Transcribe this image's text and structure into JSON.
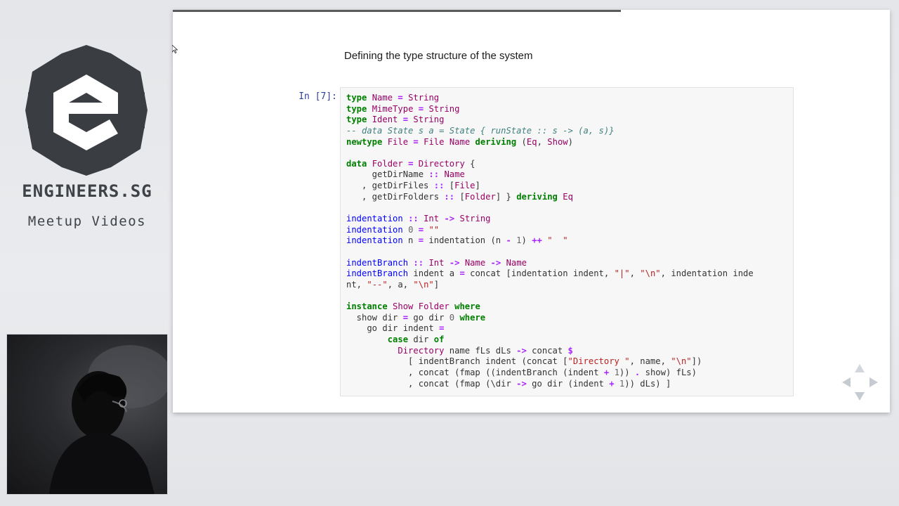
{
  "branding": {
    "name": "ENGINEERS.SG",
    "subtitle": "Meetup Videos"
  },
  "slide": {
    "title": "Defining the type structure of the system",
    "progress_fraction": 0.625,
    "cell_prompt": "In [7]:",
    "code_lines": [
      [
        {
          "t": "type",
          "c": "kw"
        },
        {
          "t": " "
        },
        {
          "t": "Name",
          "c": "type"
        },
        {
          "t": " "
        },
        {
          "t": "=",
          "c": "op"
        },
        {
          "t": " "
        },
        {
          "t": "String",
          "c": "type"
        }
      ],
      [
        {
          "t": "type",
          "c": "kw"
        },
        {
          "t": " "
        },
        {
          "t": "MimeType",
          "c": "type"
        },
        {
          "t": " "
        },
        {
          "t": "=",
          "c": "op"
        },
        {
          "t": " "
        },
        {
          "t": "String",
          "c": "type"
        }
      ],
      [
        {
          "t": "type",
          "c": "kw"
        },
        {
          "t": " "
        },
        {
          "t": "Ident",
          "c": "type"
        },
        {
          "t": " "
        },
        {
          "t": "=",
          "c": "op"
        },
        {
          "t": " "
        },
        {
          "t": "String",
          "c": "type"
        }
      ],
      [
        {
          "t": "-- data State s a = State { runState :: s -> (a, s)}",
          "c": "comment"
        }
      ],
      [
        {
          "t": "newtype",
          "c": "kw"
        },
        {
          "t": " "
        },
        {
          "t": "File",
          "c": "type"
        },
        {
          "t": " "
        },
        {
          "t": "=",
          "c": "op"
        },
        {
          "t": " "
        },
        {
          "t": "File",
          "c": "type"
        },
        {
          "t": " "
        },
        {
          "t": "Name",
          "c": "type"
        },
        {
          "t": " "
        },
        {
          "t": "deriving",
          "c": "kw"
        },
        {
          "t": " ("
        },
        {
          "t": "Eq",
          "c": "type"
        },
        {
          "t": ", "
        },
        {
          "t": "Show",
          "c": "type"
        },
        {
          "t": ")"
        }
      ],
      [],
      [
        {
          "t": "data",
          "c": "kw"
        },
        {
          "t": " "
        },
        {
          "t": "Folder",
          "c": "type"
        },
        {
          "t": " "
        },
        {
          "t": "=",
          "c": "op"
        },
        {
          "t": " "
        },
        {
          "t": "Directory",
          "c": "type"
        },
        {
          "t": " {"
        }
      ],
      [
        {
          "t": "     getDirName "
        },
        {
          "t": "::",
          "c": "op"
        },
        {
          "t": " "
        },
        {
          "t": "Name",
          "c": "type"
        }
      ],
      [
        {
          "t": "   , getDirFiles "
        },
        {
          "t": "::",
          "c": "op"
        },
        {
          "t": " ["
        },
        {
          "t": "File",
          "c": "type"
        },
        {
          "t": "]"
        }
      ],
      [
        {
          "t": "   , getDirFolders "
        },
        {
          "t": "::",
          "c": "op"
        },
        {
          "t": " ["
        },
        {
          "t": "Folder",
          "c": "type"
        },
        {
          "t": "] } "
        },
        {
          "t": "deriving",
          "c": "kw"
        },
        {
          "t": " "
        },
        {
          "t": "Eq",
          "c": "type"
        }
      ],
      [],
      [
        {
          "t": "indentation",
          "c": "name"
        },
        {
          "t": " "
        },
        {
          "t": "::",
          "c": "op"
        },
        {
          "t": " "
        },
        {
          "t": "Int",
          "c": "type"
        },
        {
          "t": " "
        },
        {
          "t": "->",
          "c": "op"
        },
        {
          "t": " "
        },
        {
          "t": "String",
          "c": "type"
        }
      ],
      [
        {
          "t": "indentation",
          "c": "name"
        },
        {
          "t": " "
        },
        {
          "t": "0",
          "c": "num"
        },
        {
          "t": " "
        },
        {
          "t": "=",
          "c": "op"
        },
        {
          "t": " "
        },
        {
          "t": "\"\"",
          "c": "str"
        }
      ],
      [
        {
          "t": "indentation",
          "c": "name"
        },
        {
          "t": " n "
        },
        {
          "t": "=",
          "c": "op"
        },
        {
          "t": " indentation (n "
        },
        {
          "t": "-",
          "c": "op"
        },
        {
          "t": " "
        },
        {
          "t": "1",
          "c": "num"
        },
        {
          "t": ") "
        },
        {
          "t": "++",
          "c": "op"
        },
        {
          "t": " "
        },
        {
          "t": "\"  \"",
          "c": "str"
        }
      ],
      [],
      [
        {
          "t": "indentBranch",
          "c": "name"
        },
        {
          "t": " "
        },
        {
          "t": "::",
          "c": "op"
        },
        {
          "t": " "
        },
        {
          "t": "Int",
          "c": "type"
        },
        {
          "t": " "
        },
        {
          "t": "->",
          "c": "op"
        },
        {
          "t": " "
        },
        {
          "t": "Name",
          "c": "type"
        },
        {
          "t": " "
        },
        {
          "t": "->",
          "c": "op"
        },
        {
          "t": " "
        },
        {
          "t": "Name",
          "c": "type"
        }
      ],
      [
        {
          "t": "indentBranch",
          "c": "name"
        },
        {
          "t": " indent a "
        },
        {
          "t": "=",
          "c": "op"
        },
        {
          "t": " concat [indentation indent, "
        },
        {
          "t": "\"|\"",
          "c": "str"
        },
        {
          "t": ", "
        },
        {
          "t": "\"\\n\"",
          "c": "str"
        },
        {
          "t": ", indentation inde"
        }
      ],
      [
        {
          "t": "nt, "
        },
        {
          "t": "\"--\"",
          "c": "str"
        },
        {
          "t": ", a, "
        },
        {
          "t": "\"\\n\"",
          "c": "str"
        },
        {
          "t": "]"
        }
      ],
      [],
      [
        {
          "t": "instance",
          "c": "kw"
        },
        {
          "t": " "
        },
        {
          "t": "Show",
          "c": "type"
        },
        {
          "t": " "
        },
        {
          "t": "Folder",
          "c": "type"
        },
        {
          "t": " "
        },
        {
          "t": "where",
          "c": "kw"
        }
      ],
      [
        {
          "t": "  show dir "
        },
        {
          "t": "=",
          "c": "op"
        },
        {
          "t": " go dir "
        },
        {
          "t": "0",
          "c": "num"
        },
        {
          "t": " "
        },
        {
          "t": "where",
          "c": "kw"
        }
      ],
      [
        {
          "t": "    go dir indent "
        },
        {
          "t": "=",
          "c": "op"
        }
      ],
      [
        {
          "t": "        "
        },
        {
          "t": "case",
          "c": "kw"
        },
        {
          "t": " dir "
        },
        {
          "t": "of",
          "c": "kw"
        }
      ],
      [
        {
          "t": "          "
        },
        {
          "t": "Directory",
          "c": "type"
        },
        {
          "t": " name fLs dLs "
        },
        {
          "t": "->",
          "c": "op"
        },
        {
          "t": " concat "
        },
        {
          "t": "$",
          "c": "op"
        }
      ],
      [
        {
          "t": "            [ indentBranch indent (concat ["
        },
        {
          "t": "\"Directory \"",
          "c": "str"
        },
        {
          "t": ", name, "
        },
        {
          "t": "\"\\n\"",
          "c": "str"
        },
        {
          "t": "])"
        }
      ],
      [
        {
          "t": "            , concat (fmap ((indentBranch (indent "
        },
        {
          "t": "+",
          "c": "op"
        },
        {
          "t": " "
        },
        {
          "t": "1",
          "c": "num"
        },
        {
          "t": ")) "
        },
        {
          "t": ".",
          "c": "op"
        },
        {
          "t": " show) fLs)"
        }
      ],
      [
        {
          "t": "            , concat (fmap (\\dir "
        },
        {
          "t": "->",
          "c": "op"
        },
        {
          "t": " go dir (indent "
        },
        {
          "t": "+",
          "c": "op"
        },
        {
          "t": " "
        },
        {
          "t": "1",
          "c": "num"
        },
        {
          "t": ")) dLs) ]"
        }
      ]
    ]
  },
  "nav": {
    "up_icon": "chevron-up",
    "down_icon": "chevron-down",
    "left_icon": "chevron-left",
    "right_icon": "chevron-right"
  },
  "colors": {
    "keyword": "#008000",
    "type": "#990066",
    "operator": "#aa22ff",
    "comment": "#408080",
    "string": "#ba2121",
    "number": "#666666",
    "function_name": "#0000ff",
    "prompt": "#303f9f"
  }
}
